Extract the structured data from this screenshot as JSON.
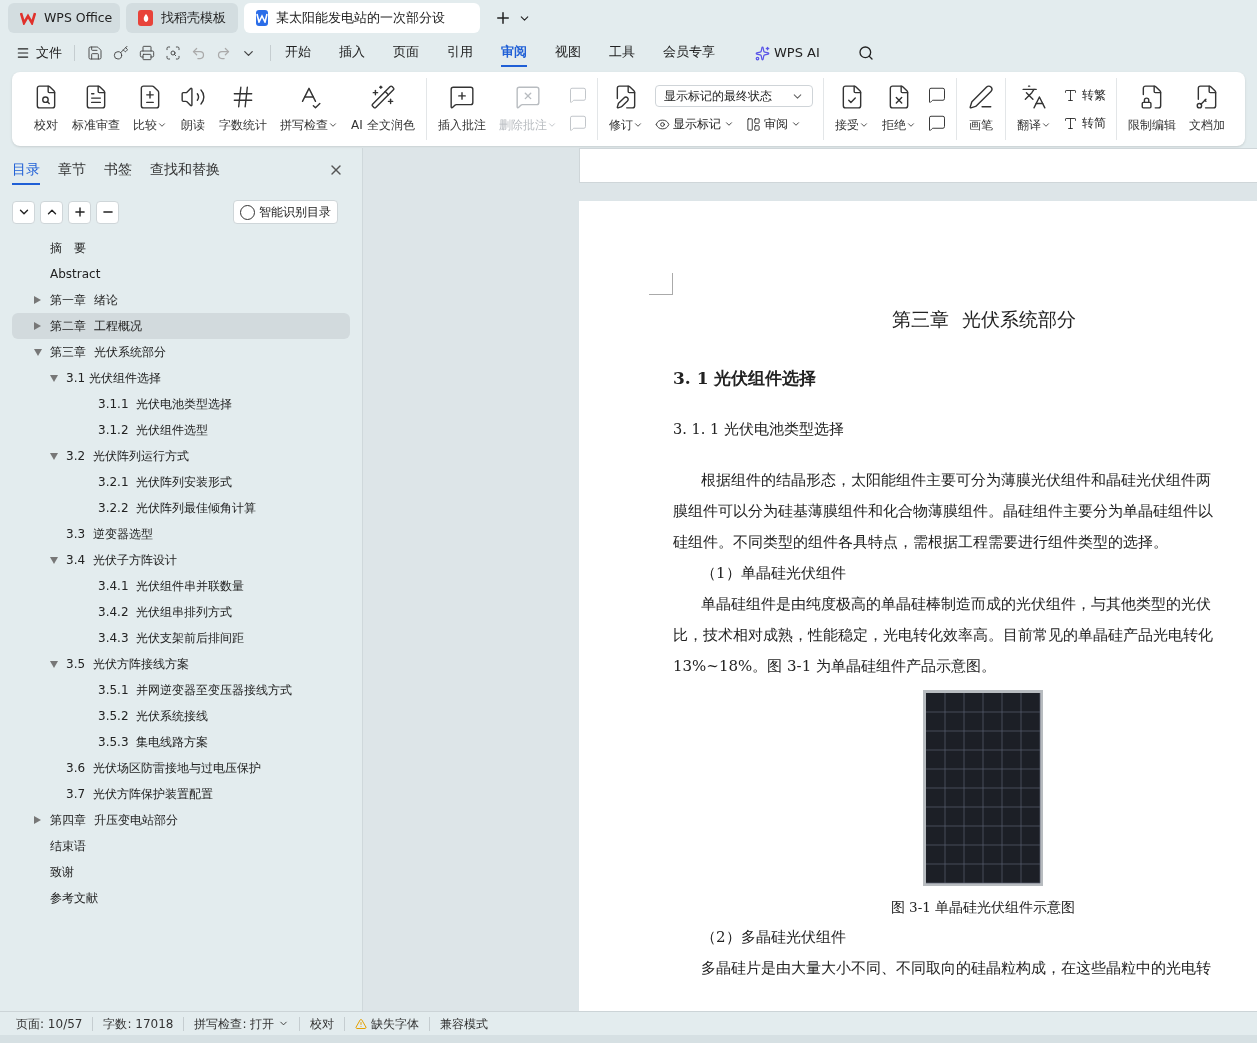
{
  "app_tabs": [
    {
      "kind": "wps",
      "label": "WPS Office",
      "selected": false
    },
    {
      "kind": "template",
      "label": "找稻壳模板",
      "selected": false
    },
    {
      "kind": "doc",
      "label": "某太阳能发电站的一次部分设",
      "selected": true
    }
  ],
  "menu": {
    "file": "文件",
    "tabs": [
      {
        "label": "开始",
        "selected": false
      },
      {
        "label": "插入",
        "selected": false
      },
      {
        "label": "页面",
        "selected": false
      },
      {
        "label": "引用",
        "selected": false
      },
      {
        "label": "审阅",
        "selected": true
      },
      {
        "label": "视图",
        "selected": false
      },
      {
        "label": "工具",
        "selected": false
      },
      {
        "label": "会员专享",
        "selected": false
      }
    ],
    "ai": "WPS AI"
  },
  "ribbon": [
    {
      "items": [
        {
          "kind": "large",
          "label": "校对"
        },
        {
          "kind": "large",
          "label": "标准审查"
        },
        {
          "kind": "large",
          "label": "比较",
          "dropdown": true
        },
        {
          "kind": "large",
          "label": "朗读"
        },
        {
          "kind": "large",
          "label": "字数统计"
        },
        {
          "kind": "large",
          "label": "拼写检查",
          "dropdown": true
        },
        {
          "kind": "large",
          "label": "AI 全文润色"
        }
      ]
    },
    {
      "items": [
        {
          "kind": "large",
          "label": "插入批注"
        },
        {
          "kind": "large",
          "label": "删除批注",
          "dropdown": true,
          "disabled": true
        },
        {
          "kind": "pair",
          "disabled": true
        }
      ]
    },
    {
      "items": [
        {
          "kind": "large",
          "label": "修订",
          "dropdown": true
        },
        {
          "kind": "stack",
          "select": "显示标记的最终状态",
          "buttons": [
            {
              "label": "显示标记",
              "dropdown": true
            },
            {
              "label": "审阅",
              "dropdown": true
            }
          ]
        }
      ]
    },
    {
      "items": [
        {
          "kind": "large",
          "label": "接受",
          "dropdown": true
        },
        {
          "kind": "large",
          "label": "拒绝",
          "dropdown": true
        },
        {
          "kind": "pair",
          "disabled": false
        }
      ]
    },
    {
      "items": [
        {
          "kind": "large",
          "label": "画笔"
        }
      ]
    },
    {
      "items": [
        {
          "kind": "large",
          "label": "翻译",
          "dropdown": true
        },
        {
          "kind": "column",
          "buttons": [
            {
              "label": "转繁"
            },
            {
              "label": "转简"
            }
          ]
        }
      ]
    },
    {
      "items": [
        {
          "kind": "large",
          "label": "限制编辑"
        },
        {
          "kind": "large",
          "label": "文档加"
        }
      ]
    }
  ],
  "sidebar": {
    "tabs": [
      {
        "label": "目录",
        "selected": true
      },
      {
        "label": "章节",
        "selected": false
      },
      {
        "label": "书签",
        "selected": false
      },
      {
        "label": "查找和替换",
        "selected": false
      }
    ],
    "smart_button": "智能识别目录",
    "toc": [
      {
        "text": "摘　要",
        "selected": false
      },
      {
        "text": "Abstract",
        "selected": false
      },
      {
        "text": "第一章  绪论",
        "selected": false,
        "expanded": false
      },
      {
        "text": "第二章  工程概况",
        "selected": true,
        "expanded": false
      },
      {
        "text": "第三章  光伏系统部分",
        "selected": false,
        "expanded": true,
        "children": [
          {
            "text": "3.1 光伏组件选择",
            "selected": false,
            "expanded": true,
            "children": [
              {
                "text": "3.1.1  光伏电池类型选择",
                "selected": false
              },
              {
                "text": "3.1.2  光伏组件选型",
                "selected": false
              }
            ]
          },
          {
            "text": "3.2  光伏阵列运行方式",
            "selected": false,
            "expanded": true,
            "children": [
              {
                "text": "3.2.1  光伏阵列安装形式",
                "selected": false
              },
              {
                "text": "3.2.2  光伏阵列最佳倾角计算",
                "selected": false
              }
            ]
          },
          {
            "text": "3.3  逆变器选型",
            "selected": false
          },
          {
            "text": "3.4  光伏子方阵设计",
            "selected": false,
            "expanded": true,
            "children": [
              {
                "text": "3.4.1  光伏组件串并联数量",
                "selected": false
              },
              {
                "text": "3.4.2  光伏组串排列方式",
                "selected": false
              },
              {
                "text": "3.4.3  光伏支架前后排间距",
                "selected": false
              }
            ]
          },
          {
            "text": "3.5  光伏方阵接线方案",
            "selected": false,
            "expanded": true,
            "children": [
              {
                "text": "3.5.1  并网逆变器至变压器接线方式",
                "selected": false
              },
              {
                "text": "3.5.2  光伏系统接线",
                "selected": false
              },
              {
                "text": "3.5.3  集电线路方案",
                "selected": false
              }
            ]
          },
          {
            "text": "3.6  光伏场区防雷接地与过电压保护",
            "selected": false
          },
          {
            "text": "3.7  光伏方阵保护装置配置",
            "selected": false
          }
        ]
      },
      {
        "text": "第四章  升压变电站部分",
        "selected": false,
        "expanded": false
      },
      {
        "text": "结束语",
        "selected": false
      },
      {
        "text": "致谢",
        "selected": false
      },
      {
        "text": "参考文献",
        "selected": false
      }
    ]
  },
  "document": {
    "chapter_title": "第三章  光伏系统部分",
    "section_title": "3. 1 光伏组件选择",
    "subsection_title": "3. 1. 1 光伏电池类型选择",
    "lines": [
      {
        "kind": "first",
        "text": "根据组件的结晶形态，太阳能组件主要可分为薄膜光伏组件和晶硅光伏组件两"
      },
      {
        "kind": "body",
        "text": "膜组件可以分为硅基薄膜组件和化合物薄膜组件。晶硅组件主要分为单晶硅组件以"
      },
      {
        "kind": "body",
        "text": "硅组件。不同类型的组件各具特点，需根据工程需要进行组件类型的选择。"
      },
      {
        "kind": "first",
        "text": "（1）单晶硅光伏组件"
      },
      {
        "kind": "first",
        "text": "单晶硅组件是由纯度极高的单晶硅棒制造而成的光伏组件，与其他类型的光伏"
      },
      {
        "kind": "body",
        "text": "比，技术相对成熟，性能稳定，光电转化效率高。目前常见的单晶硅产品光电转化"
      },
      {
        "kind": "body",
        "text": "13%~18%。图 3-1 为单晶硅组件产品示意图。"
      },
      {
        "kind": "figure",
        "text": "图 3-1 单晶硅光伏组件示意图"
      },
      {
        "kind": "first",
        "text": "（2）多晶硅光伏组件"
      },
      {
        "kind": "first",
        "text": "多晶硅片是由大量大小不同、不同取向的硅晶粒构成，在这些晶粒中的光电转"
      }
    ]
  },
  "status_bar": [
    {
      "kind": "text",
      "text": "页面: 10/57"
    },
    {
      "kind": "text",
      "text": "字数: 17018"
    },
    {
      "kind": "dropdown",
      "text": "拼写检查: 打开"
    },
    {
      "kind": "text",
      "text": "校对"
    },
    {
      "kind": "warning",
      "text": "缺失字体"
    },
    {
      "kind": "text",
      "text": "兼容模式"
    }
  ]
}
